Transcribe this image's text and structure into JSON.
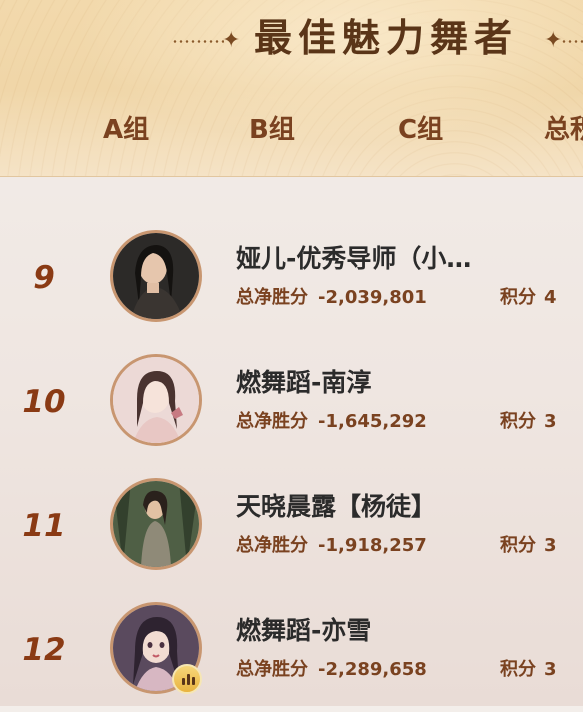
{
  "header": {
    "title": "最佳魅力舞者",
    "tabs": [
      "A组",
      "B组",
      "C组",
      "总积"
    ]
  },
  "labels": {
    "net_win": "总净胜分",
    "points": "积分"
  },
  "rankings": [
    {
      "rank": "9",
      "name": "娅儿-优秀导师（小…",
      "net_win": "-2,039,801",
      "points": "4"
    },
    {
      "rank": "10",
      "name": "燃舞蹈-南淳",
      "net_win": "-1,645,292",
      "points": "3"
    },
    {
      "rank": "11",
      "name": "天晓晨露【杨徒】",
      "net_win": "-1,918,257",
      "points": "3"
    },
    {
      "rank": "12",
      "name": "燃舞蹈-亦雪",
      "net_win": "-2,289,658",
      "points": "3"
    }
  ],
  "colors": {
    "header_gold": "#f0d6a8",
    "title_brown": "#5a3518",
    "rank_red_brown": "#8a3a14",
    "label_brown": "#7a4220",
    "name_dark": "#2b2b2b"
  },
  "icons": {
    "badge": "live-bars-icon",
    "title_ornament": "sparkle-icon"
  }
}
